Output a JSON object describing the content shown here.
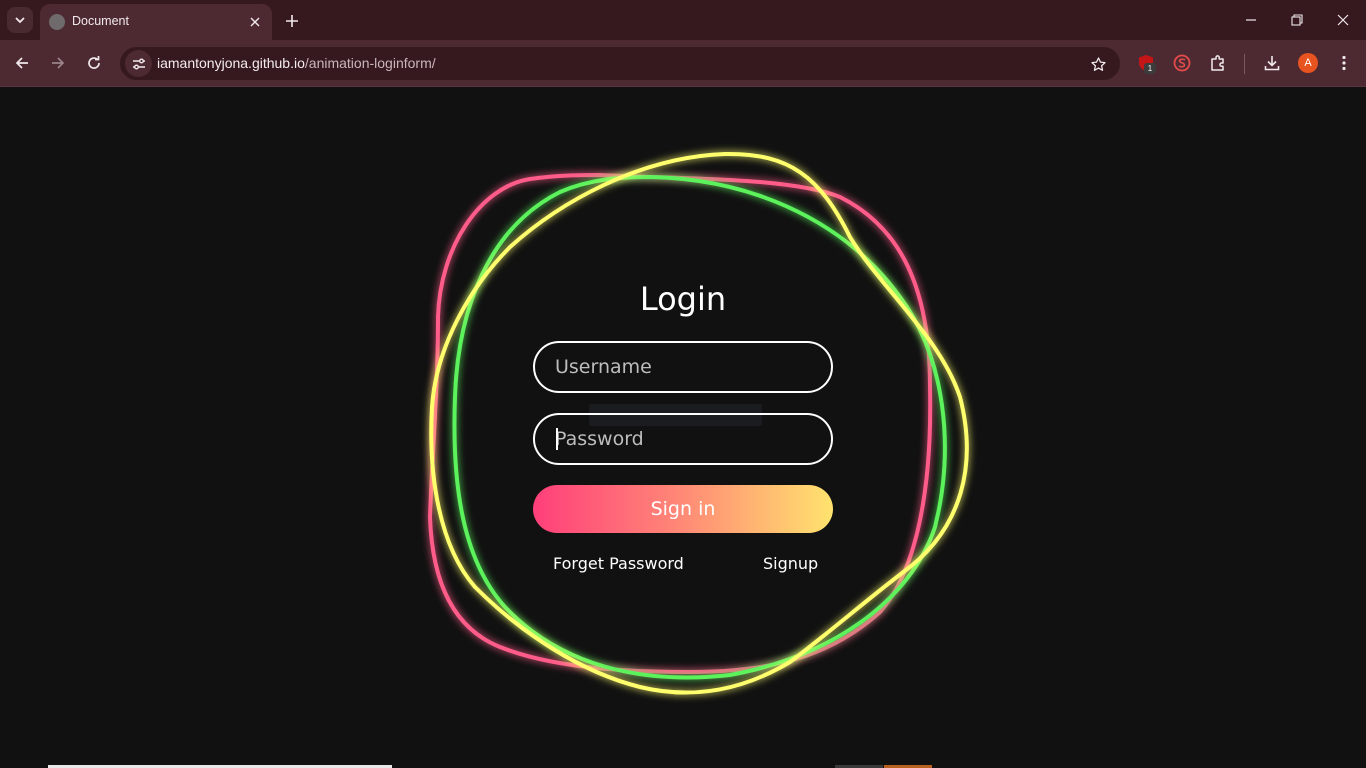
{
  "browser": {
    "tab": {
      "title": "Document"
    },
    "address": {
      "host": "iamantonyjona.github.io",
      "path": "/animation-loginform/"
    },
    "extensions": [
      {
        "icon": "ublock-icon",
        "badge": "1"
      },
      {
        "icon": "s-shield-icon"
      },
      {
        "icon": "puzzle-extensions-icon"
      }
    ],
    "profile_initial": "A",
    "colors": {
      "tabbar": "#35191f",
      "toolbar": "#4d2a32"
    }
  },
  "page": {
    "title": "Login",
    "username": {
      "placeholder": "Username"
    },
    "password": {
      "placeholder": "Password"
    },
    "signin_label": "Sign in",
    "forget_label": "Forget Password",
    "signup_label": "Signup",
    "ring_colors": [
      "#ff5c8a",
      "#5cf25c",
      "#ffff6e"
    ],
    "button_gradient": [
      "#ff3f7a",
      "#ffe36e"
    ],
    "background": "#111111"
  }
}
